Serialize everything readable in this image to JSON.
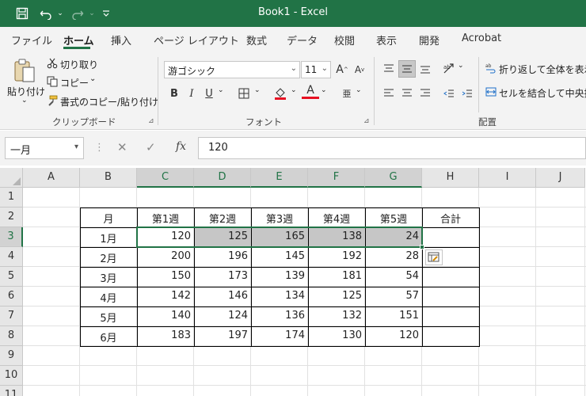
{
  "titlebar": {
    "title": "Book1  -  Excel",
    "icons": [
      "save-icon",
      "undo-icon",
      "redo-icon",
      "customize-qat-icon"
    ]
  },
  "tabs": [
    {
      "label": "ファイル",
      "active": false
    },
    {
      "label": "ホーム",
      "active": true
    },
    {
      "label": "挿入",
      "active": false
    },
    {
      "label": "ページ レイアウト",
      "active": false
    },
    {
      "label": "数式",
      "active": false
    },
    {
      "label": "データ",
      "active": false
    },
    {
      "label": "校閲",
      "active": false
    },
    {
      "label": "表示",
      "active": false
    },
    {
      "label": "開発",
      "active": false
    },
    {
      "label": "Acrobat",
      "active": false
    }
  ],
  "ribbon": {
    "clipboard": {
      "paste": "貼り付け",
      "cut": "切り取り",
      "copy": "コピー",
      "format_painter": "書式のコピー/貼り付け",
      "label": "クリップボード"
    },
    "font": {
      "name": "游ゴシック",
      "size": "11",
      "grow": "A",
      "shrink": "A",
      "bold": "B",
      "italic": "I",
      "underline": "U",
      "font_color": "A",
      "phonetic": "亜",
      "label": "フォント",
      "accent_red": "#e81123"
    },
    "alignment": {
      "wrap_text": "折り返して全体を表示する",
      "merge_center": "セルを結合して中央揃え",
      "label": "配置"
    }
  },
  "formula_bar": {
    "name_box": "一月",
    "fx": "fx",
    "value": "120"
  },
  "grid": {
    "columns": [
      "A",
      "B",
      "C",
      "D",
      "E",
      "F",
      "G",
      "H",
      "I",
      "J"
    ],
    "rows": [
      "1",
      "2",
      "3",
      "4",
      "5",
      "6",
      "7",
      "8",
      "9",
      "10",
      "11"
    ],
    "selected_columns": [
      "C",
      "D",
      "E",
      "F",
      "G"
    ],
    "selected_row": "3",
    "accent": "#217346"
  },
  "table": {
    "header": [
      "月",
      "第1週",
      "第2週",
      "第3週",
      "第4週",
      "第5週",
      "合計"
    ],
    "rows": [
      [
        "1月",
        "120",
        "125",
        "165",
        "138",
        "24",
        ""
      ],
      [
        "2月",
        "200",
        "196",
        "145",
        "192",
        "28",
        ""
      ],
      [
        "3月",
        "150",
        "173",
        "139",
        "181",
        "54",
        ""
      ],
      [
        "4月",
        "142",
        "146",
        "134",
        "125",
        "57",
        ""
      ],
      [
        "5月",
        "140",
        "124",
        "136",
        "132",
        "151",
        ""
      ],
      [
        "6月",
        "183",
        "197",
        "174",
        "130",
        "120",
        ""
      ]
    ]
  }
}
